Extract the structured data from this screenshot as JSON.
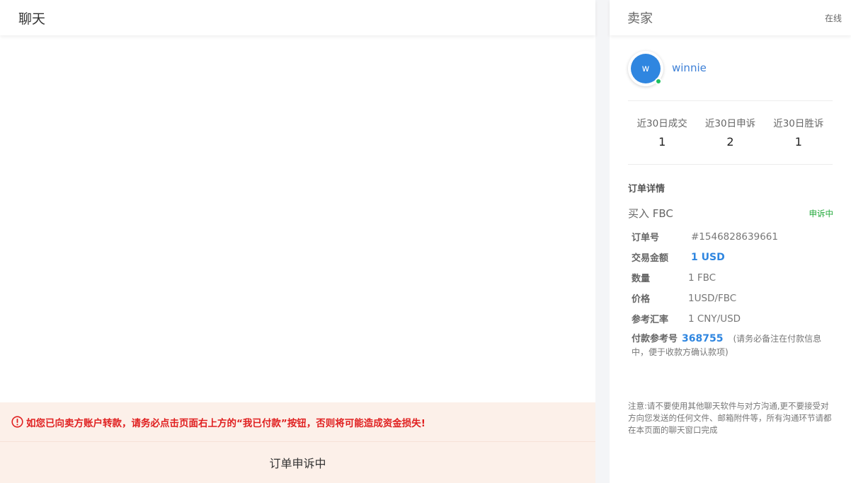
{
  "chat": {
    "title": "聊天",
    "warning": "如您已向卖方账户转款，请务必点击页面右上方的“我已付款”按钮，否则将可能造成资金损失!",
    "appeal_status": "订单申诉中"
  },
  "seller": {
    "title": "卖家",
    "online": "在线",
    "avatar_initial": "w",
    "username": "winnie",
    "stats": [
      {
        "label": "近30日成交",
        "value": "1"
      },
      {
        "label": "近30日申诉",
        "value": "2"
      },
      {
        "label": "近30日胜诉",
        "value": "1"
      }
    ]
  },
  "order": {
    "title": "订单详情",
    "type": "买入 FBC",
    "status": "申诉中",
    "order_no_label": "订单号",
    "order_no": "#1546828639661",
    "amount_label": "交易金额",
    "amount": "1 USD",
    "quantity_label": "数量",
    "quantity": "1 FBC",
    "price_label": "价格",
    "price": "1USD/FBC",
    "rate_label": "参考汇率",
    "rate": "1 CNY/USD",
    "ref_label": "付款参考号",
    "ref_no": "368755",
    "ref_note": "(请务必备注在付款信息中，便于收款方确认款项)"
  },
  "notice": "注意:请不要使用其他聊天软件与对方沟通,更不要接受对方向您发送的任何文件、邮箱附件等，所有沟通环节请都在本页面的聊天窗口完成",
  "colors": {
    "accent_blue": "#2f86e0",
    "warning_red": "#e02020",
    "status_green": "#23a93b",
    "online_green": "#1ec15f",
    "footer_bg": "#fcf0e9"
  }
}
